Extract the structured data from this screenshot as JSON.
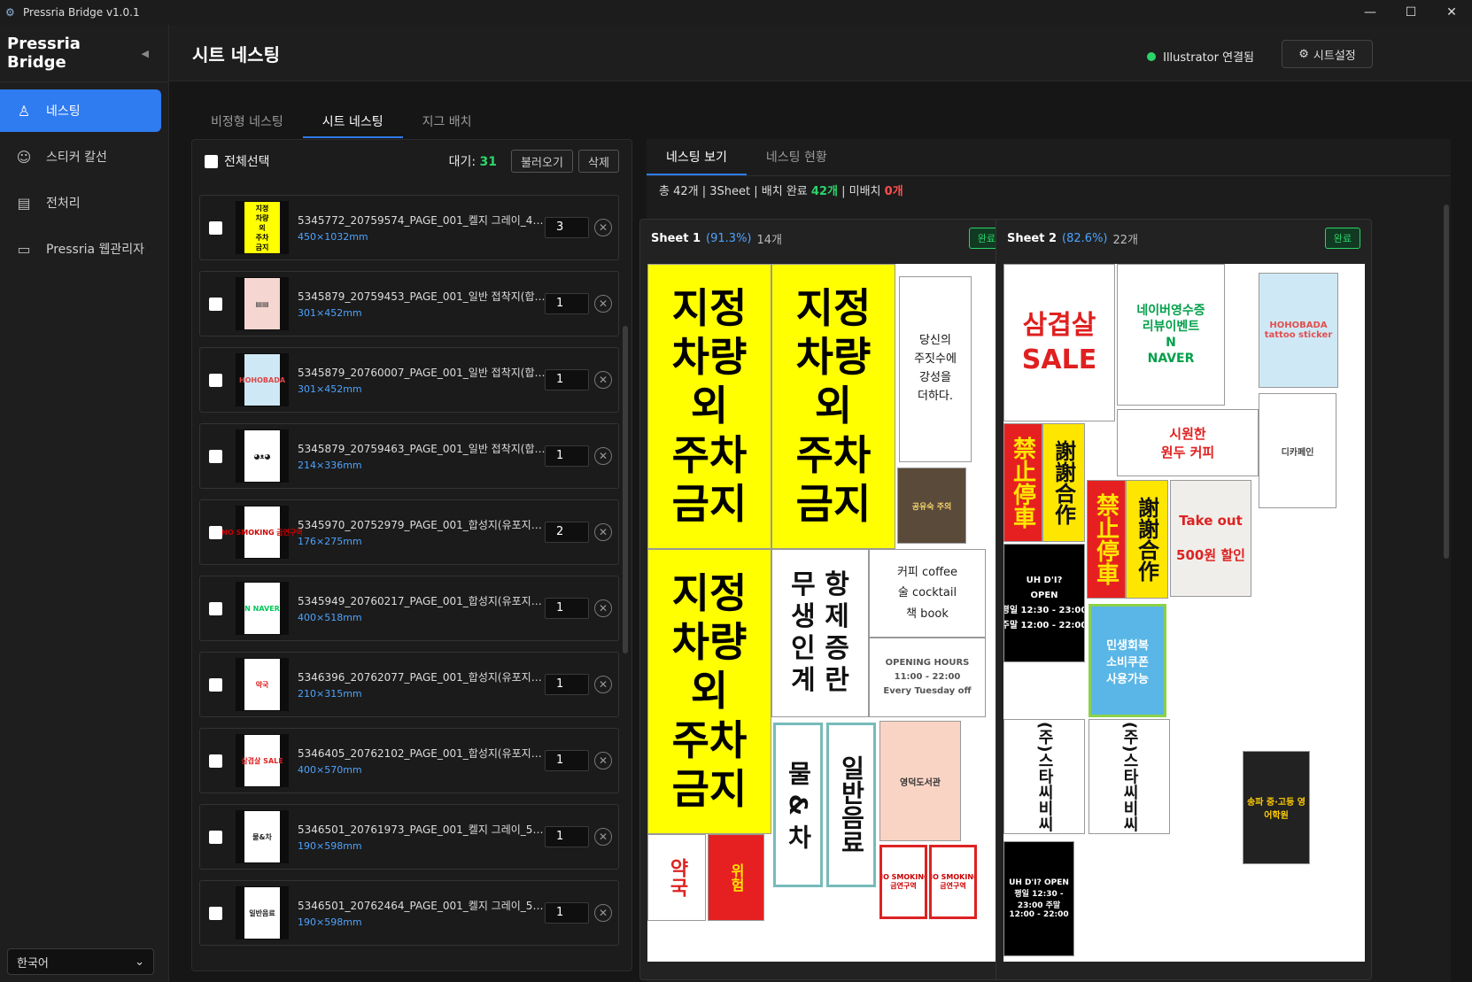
{
  "window": {
    "title": "Pressria Bridge v1.0.1"
  },
  "sidebar": {
    "brand": "Pressria Bridge",
    "items": [
      {
        "label": "네스팅",
        "icon": "bottle-icon",
        "active": true
      },
      {
        "label": "스티커 칼선",
        "icon": "sticker-icon",
        "active": false
      },
      {
        "label": "전처리",
        "icon": "document-icon",
        "active": false
      },
      {
        "label": "Pressria 웹관리자",
        "icon": "monitor-icon",
        "active": false
      }
    ],
    "language": "한국어"
  },
  "header": {
    "title": "시트 네스팅",
    "connection_status": "Illustrator 연결됨",
    "settings_label": "시트설정"
  },
  "tabs": [
    {
      "label": "비정형 네스팅",
      "active": false
    },
    {
      "label": "시트 네스팅",
      "active": true
    },
    {
      "label": "지그 배치",
      "active": false
    }
  ],
  "file_panel": {
    "select_all_label": "전체선택",
    "wait_label": "대기:",
    "wait_count": "31",
    "load_label": "불러오기",
    "delete_label": "삭제",
    "files": [
      {
        "name": "5345772_20759574_PAGE_001_켈지 그레이_450m...",
        "size": "450×1032mm",
        "qty": "3",
        "thumb": "지정\n차량\n외\n주차\n금지",
        "bg": "#ffff00",
        "fg": "#000"
      },
      {
        "name": "5345879_20759453_PAGE_001_일반 접착지(합성지)...",
        "size": "301×452mm",
        "qty": "1",
        "thumb": "▤▤",
        "bg": "#f6d6d0",
        "fg": "#333"
      },
      {
        "name": "5345879_20760007_PAGE_001_일반 접착지(합성지)...",
        "size": "301×452mm",
        "qty": "1",
        "thumb": "HOHOBADA",
        "bg": "#cfe8f5",
        "fg": "#d44"
      },
      {
        "name": "5345879_20759463_PAGE_001_일반 접착지(합성지)...",
        "size": "214×336mm",
        "qty": "1",
        "thumb": "◕ᴥ◕",
        "bg": "#ffffff",
        "fg": "#222"
      },
      {
        "name": "5345970_20752979_PAGE_001_합성지(유포지)_17...",
        "size": "176×275mm",
        "qty": "2",
        "thumb": "NO SMOKING 금연구역",
        "bg": "#ffffff",
        "fg": "#c00"
      },
      {
        "name": "5345949_20760217_PAGE_001_합성지(유포지)_40...",
        "size": "400×518mm",
        "qty": "1",
        "thumb": "N NAVER",
        "bg": "#ffffff",
        "fg": "#03c75a"
      },
      {
        "name": "5346396_20762077_PAGE_001_합성지(유포지)_29...",
        "size": "210×315mm",
        "qty": "1",
        "thumb": "약국",
        "bg": "#ffffff",
        "fg": "#d22"
      },
      {
        "name": "5346405_20762102_PAGE_001_합성지(유포지)_40...",
        "size": "400×570mm",
        "qty": "1",
        "thumb": "삼겹살 SALE",
        "bg": "#ffffff",
        "fg": "#d22"
      },
      {
        "name": "5346501_20761973_PAGE_001_켈지 그레이_580m...",
        "size": "190×598mm",
        "qty": "1",
        "thumb": "물&차",
        "bg": "#ffffff",
        "fg": "#222"
      },
      {
        "name": "5346501_20762464_PAGE_001_켈지 그레이_580m...",
        "size": "190×598mm",
        "qty": "1",
        "thumb": "일반음료",
        "bg": "#ffffff",
        "fg": "#222"
      }
    ]
  },
  "result_panel": {
    "tabs": [
      {
        "label": "네스팅 보기",
        "active": true
      },
      {
        "label": "네스팅 현황",
        "active": false
      }
    ],
    "summary": {
      "total": "총 42개",
      "sheets": "3Sheet",
      "placed_label": "배치 완료",
      "placed": "42개",
      "unplaced_label": "미배치",
      "unplaced": "0개"
    },
    "sheets": [
      {
        "name": "Sheet 1",
        "pct": "(91.3%)",
        "count": "14개",
        "status": "완료"
      },
      {
        "name": "Sheet 2",
        "pct": "(82.6%)",
        "count": "22개",
        "status": "완료"
      }
    ],
    "sheet1_tiles": {
      "parking": "지정\n차량\n외\n주차\n금지",
      "sensibility": "당신의\n주짓수에\n강성을\n더하다.",
      "notice": "공유숙 주의",
      "slogan": "무 항\n생 제\n인 증\n계 란",
      "cafe": "커피 coffee\n술 cocktail\n책 book",
      "hours": "OPENING HOURS\n11:00 - 22:00\nEvery Tuesday off",
      "water_tea": "물 & 차",
      "soft_drink": "일반음료",
      "library": "영덕도서관",
      "pharmacy": "약국",
      "danger": "위험",
      "no_smoking": "NO SMOKING\n금연구역"
    },
    "sheet2_tiles": {
      "pork": "삼겹살\nSALE",
      "naver_event": "네이버영수증\n리뷰이벤트\nN\nNAVER",
      "hohobada": "HOHOBADA\ntattoo sticker",
      "cafe_sign": "시원한\n원두 커피",
      "no_parking": "禁止停車",
      "thanks": "謝謝合作",
      "takeout": "Take out\n500원 할인",
      "open": "UH D'I?\nOPEN\n평일 12:30 - 23:00\n주말 12:00 - 22:00",
      "coupon": "민생회복\n소비쿠폰\n사용가능",
      "cbc": "(주)스타씨비씨",
      "menu": "디카페인",
      "academy": "송파 중·고등 영어학원"
    }
  },
  "colors": {
    "accent": "#2f7bf0",
    "success": "#2bd46a",
    "danger": "#ff4d4d",
    "link": "#4da3ff"
  }
}
